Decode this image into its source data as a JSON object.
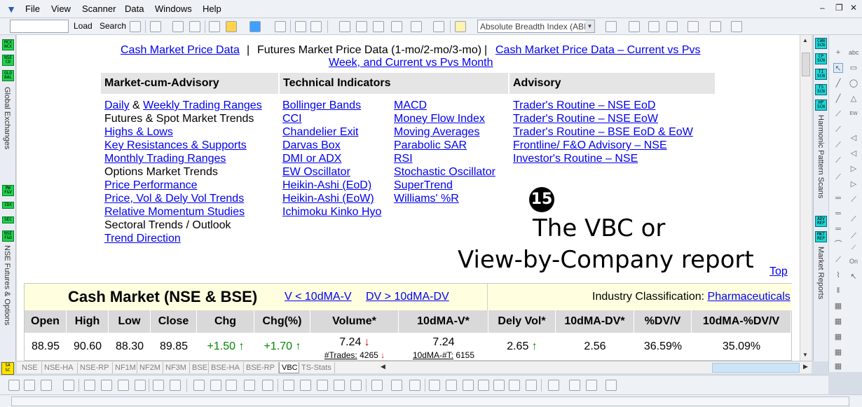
{
  "menu": {
    "items": [
      "File",
      "View",
      "Scanner",
      "Data",
      "Windows",
      "Help"
    ]
  },
  "toolbar": {
    "load_label": "Load",
    "search_label": "Search",
    "indicator_select": "Absolute Breadth Index (ABI"
  },
  "left_panel": {
    "tags_top": [
      "MCX NCX",
      "NSE CD",
      "GLO BAL"
    ],
    "label_top": "Global Exchanges",
    "tags_bottom": [
      "MW F&V",
      "IDX",
      "SEC",
      "NSE F&O"
    ],
    "label_bottom": "NSE Futures & Options",
    "sac": "SA SC"
  },
  "right_panel": {
    "tags_top": [
      "CAN SCN",
      "CP SCN",
      "TI SCN",
      "TS SCN",
      "HP SCN"
    ],
    "label_top": "Harmonic Pattern Scans",
    "tags_bottom": [
      "ADV REP",
      "MKT REP"
    ],
    "label_bottom": "Market Reports"
  },
  "nav": {
    "link1": "Cash Market Price Data",
    "sep1": "|",
    "current": "Futures Market Price Data (1-mo/2-mo/3-mo)",
    "sep2": "|",
    "link2a": "Cash Market Price Data – Current vs Pvs",
    "link2b": "Week, and Current vs Pvs Month"
  },
  "headers": {
    "market": "Market-cum-Advisory",
    "tech": "Technical Indicators",
    "advisory": "Advisory"
  },
  "market_items": [
    {
      "parts": [
        {
          "t": "Daily",
          "link": true
        },
        {
          "t": " & ",
          "link": false
        },
        {
          "t": "Weekly Trading Ranges",
          "link": true
        }
      ]
    },
    {
      "parts": [
        {
          "t": "Futures & Spot Market Trends",
          "link": false
        }
      ]
    },
    {
      "parts": [
        {
          "t": "Highs & Lows",
          "link": true
        }
      ]
    },
    {
      "parts": [
        {
          "t": "Key Resistances & Supports",
          "link": true
        }
      ]
    },
    {
      "parts": [
        {
          "t": "Monthly Trading Ranges",
          "link": true
        }
      ]
    },
    {
      "parts": [
        {
          "t": "Options Market Trends",
          "link": false
        }
      ]
    },
    {
      "parts": [
        {
          "t": "Price Performance",
          "link": true
        }
      ]
    },
    {
      "parts": [
        {
          "t": "Price, Vol & Dely Vol Trends",
          "link": true
        }
      ]
    },
    {
      "parts": [
        {
          "t": "Relative Momentum Studies",
          "link": true
        }
      ]
    },
    {
      "parts": [
        {
          "t": "Sectoral Trends / Outlook",
          "link": false
        }
      ]
    },
    {
      "parts": [
        {
          "t": "Trend Direction",
          "link": true
        }
      ]
    }
  ],
  "tech_col1": [
    "Bollinger Bands",
    "CCI",
    "Chandelier Exit",
    "Darvas Box",
    "DMI or ADX",
    "EW Oscillator",
    "Heikin-Ashi (EoD)",
    "Heikin-Ashi (EoW)",
    "Ichimoku Kinko Hyo"
  ],
  "tech_col2": [
    "MACD",
    "Money Flow Index",
    "Moving Averages",
    "Parabolic SAR",
    "RSI",
    "Stochastic Oscillator",
    "SuperTrend",
    "Williams' %R"
  ],
  "advisory_items": [
    "Trader's Routine – NSE EoD",
    "Trader's Routine – NSE EoW",
    "Trader's Routine – BSE EoD & EoW",
    "Frontline/ F&O Advisory – NSE",
    "Investor's Routine – NSE"
  ],
  "annotation": {
    "number": "15",
    "line1": "The VBC or",
    "line2": "View-by-Company report"
  },
  "top_link": "Top",
  "cash_market": {
    "title": "Cash Market (NSE & BSE)",
    "link1": "V < 10dMA-V",
    "link2": "DV > 10dMA-DV",
    "industry_label": "Industry Classification: ",
    "industry_value": "Pharmaceuticals",
    "columns": [
      "Open",
      "High",
      "Low",
      "Close",
      "Chg",
      "Chg(%)",
      "Volume*",
      "10dMA-V*",
      "Dely Vol*",
      "10dMA-DV*",
      "%DV/V",
      "10dMA-%DV/V"
    ],
    "row": {
      "open": "88.95",
      "high": "90.60",
      "low": "88.30",
      "close": "89.85",
      "chg": "+1.50",
      "chg_arrow": "↑",
      "chg_pct": "+1.70",
      "chg_pct_arrow": "↑",
      "volume": "7.24",
      "volume_arrow": "↓",
      "trades_label": "#Trades:",
      "trades": "4265",
      "trades_arrow": "↓",
      "ma_v": "7.24",
      "ma_trades_label": "10dMA-#T:",
      "ma_trades": "6155",
      "dely_vol": "2.65",
      "dely_arrow": "↑",
      "ma_dv": "2.56",
      "pct_dv": "36.59%",
      "ma_pct_dv": "35.09%"
    }
  },
  "tabs": [
    "NSE",
    "NSE-HA",
    "NSE-RP",
    "NF1M",
    "NF2M",
    "NF3M",
    "BSE",
    "BSE-HA",
    "BSE-RP",
    "VBC",
    "TS-Stats"
  ],
  "active_tab": "VBC",
  "colors": {
    "link": "#0000ee",
    "up": "#008800",
    "down": "#dd0000",
    "header_bg": "#e5e5e5",
    "panel_bg": "#ffffe0",
    "tag_green": "#1fd34c",
    "tag_cyan": "#1fd3d3"
  }
}
